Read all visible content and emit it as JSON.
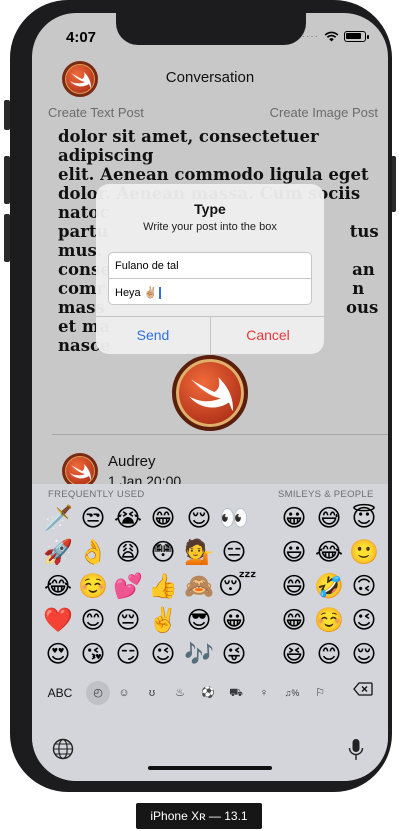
{
  "status": {
    "time": "4:07"
  },
  "nav": {
    "title": "Conversation"
  },
  "toolbar": {
    "create_text": "Create Text Post",
    "create_image": "Create Image Post"
  },
  "post": {
    "lines": [
      "dolor sit amet, consectetuer adipiscing",
      "elit. Aenean commodo ligula eget",
      "dolor. Aenean massa. Cum sociis",
      "natoc",
      "partu                                          tus",
      "mus.",
      "conse                                          an",
      "comr                                           n",
      "mass                                          ous",
      "et ma",
      "nasce"
    ]
  },
  "comment": {
    "author": "Audrey",
    "time": "1 Jan 20:00"
  },
  "alert": {
    "title": "Type",
    "message": "Write your post into the box",
    "name_value": "Fulano de tal",
    "post_value": "Heya ✌🏼",
    "send_label": "Send",
    "cancel_label": "Cancel"
  },
  "keyboard": {
    "cat_frequent": "FREQUENTLY USED",
    "cat_smileys": "SMILEYS & PEOPLE",
    "abc_label": "ABC",
    "frequent_rows": [
      [
        "🗡️",
        "😒",
        "😭",
        "😁",
        "😌",
        "👀"
      ],
      [
        "🚀",
        "👌",
        "😩",
        "😳",
        "💁",
        "😑"
      ],
      [
        "😂",
        "☺️",
        "💕",
        "👍",
        "🙈",
        "😴"
      ],
      [
        "❤️",
        "😊",
        "😔",
        "✌️",
        "😎",
        "😀"
      ],
      [
        "😍",
        "😘",
        "😏",
        "😉",
        "🎶",
        "😜"
      ]
    ],
    "smiley_rows": [
      [
        "😀",
        "😅",
        "😇"
      ],
      [
        "😃",
        "😂",
        "🙂"
      ],
      [
        "😄",
        "🤣",
        "🙃"
      ],
      [
        "😁",
        "☺️",
        "😉"
      ],
      [
        "😆",
        "😊",
        "😌"
      ]
    ],
    "category_icons": [
      "clock-icon",
      "smiley-icon",
      "animal-icon",
      "food-icon",
      "ball-icon",
      "car-icon",
      "bulb-icon",
      "symbols-icon",
      "flag-icon"
    ]
  },
  "caption": "iPhone Xʀ — 13.1",
  "colors": {
    "accent": "#2f6fe0",
    "destructive": "#e5383b",
    "keyboard_bg": "#d3d5da"
  }
}
